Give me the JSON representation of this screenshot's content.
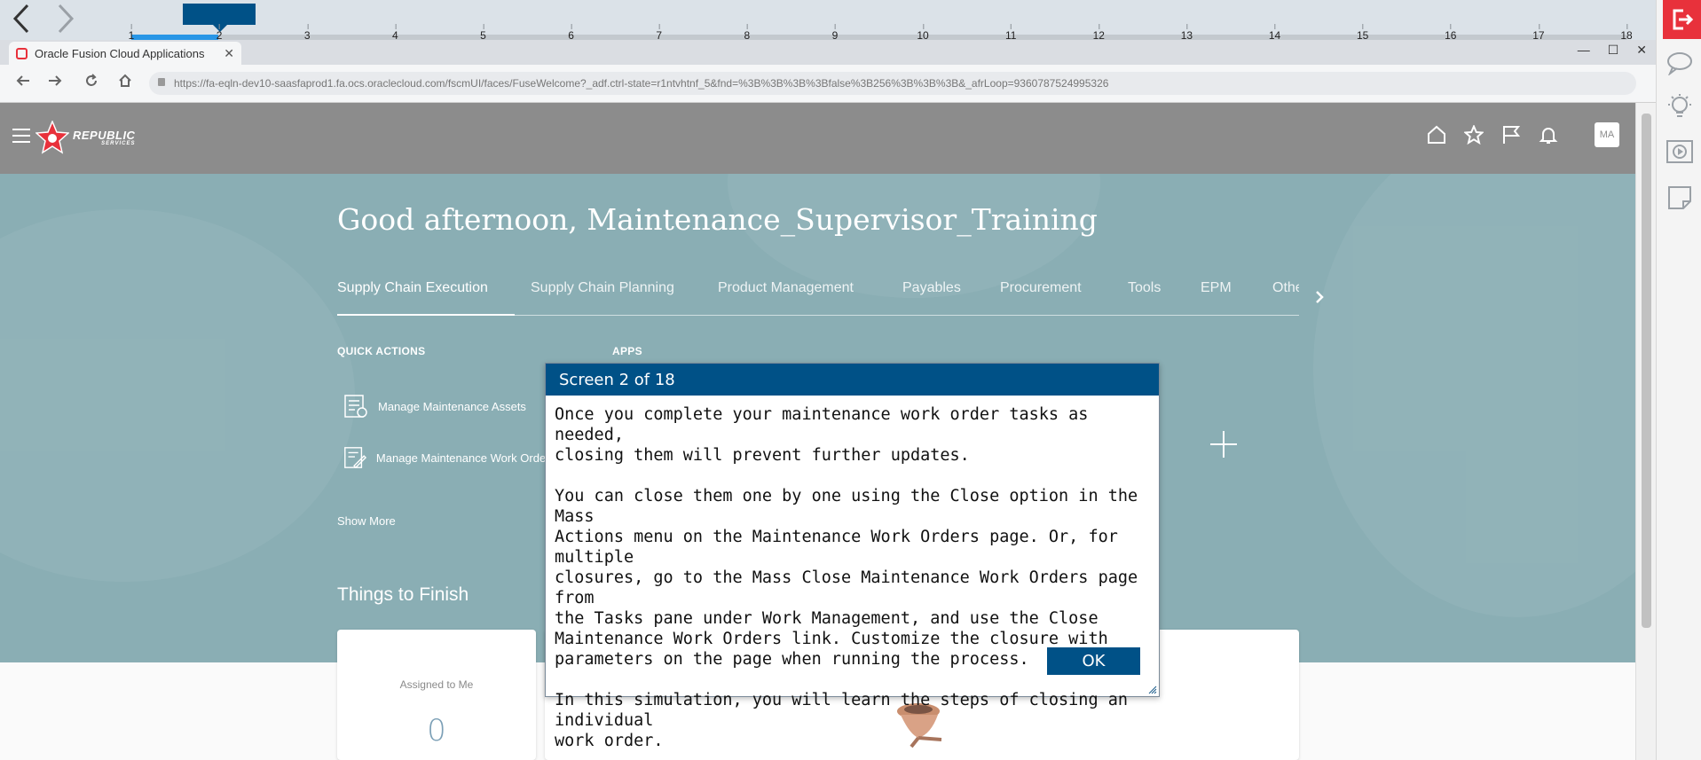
{
  "sim": {
    "ticks": [
      "1",
      "2",
      "3",
      "4",
      "5",
      "6",
      "7",
      "8",
      "9",
      "10",
      "11",
      "12",
      "13",
      "14",
      "15",
      "16",
      "17",
      "18"
    ]
  },
  "browser": {
    "tab_title": "Oracle Fusion Cloud Applications",
    "tab_close": "✕",
    "win_minimize": "—",
    "win_maximize": "☐",
    "win_close": "✕",
    "url": "https://fa-eqln-dev10-saasfaprod1.fa.ocs.oraclecloud.com/fscmUI/faces/FuseWelcome?_adf.ctrl-state=r1ntvhtnf_5&fnd=%3B%3B%3B%3Bfalse%3B256%3B%3B%3B&_afrLoop=9360787524995326"
  },
  "header": {
    "logo_line1": "REPUBLIC",
    "logo_line2": "SERVICES",
    "avatar": "MA"
  },
  "welcome": {
    "greeting": "Good afternoon, Maintenance_Supervisor_Training",
    "tabs": [
      "Supply Chain Execution",
      "Supply Chain Planning",
      "Product Management",
      "Payables",
      "Procurement",
      "Tools",
      "EPM",
      "Others"
    ],
    "quick_actions_heading": "QUICK ACTIONS",
    "apps_heading": "APPS",
    "quick_actions": [
      "Manage Maintenance Assets",
      "Manage Maintenance Work Orders"
    ],
    "show_more": "Show More",
    "things_to_finish": "Things to Finish",
    "assigned_label": "Assigned to Me",
    "assigned_count": "0"
  },
  "popup": {
    "title": "Screen 2 of 18",
    "para1": "Once you complete your maintenance work order tasks as needed,\nclosing them will prevent further updates.",
    "para2": "You can close them one by one using the Close option in the Mass\nActions menu on the Maintenance Work Orders page. Or, for multiple\nclosures, go to the Mass Close Maintenance Work Orders page from\nthe Tasks pane under Work Management, and use the Close\nMaintenance Work Orders link. Customize the closure with\nparameters on the page when running the process.",
    "para3": "In this simulation, you will learn the steps of closing an individual\nwork order.",
    "ok_label": "OK"
  }
}
